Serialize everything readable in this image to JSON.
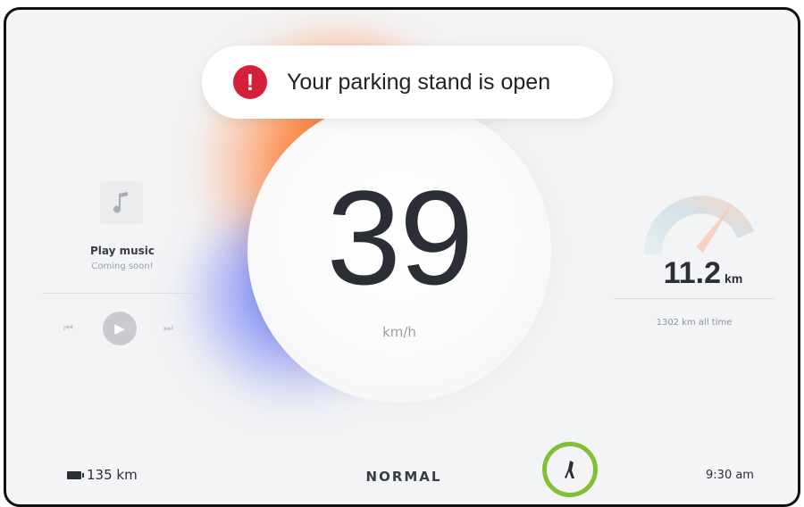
{
  "notification": {
    "icon": "alert-icon",
    "icon_glyph": "!",
    "message": "Your parking stand is open",
    "icon_color": "#d31f3a"
  },
  "speedometer": {
    "value": "39",
    "unit": "km/h"
  },
  "music": {
    "title": "Play music",
    "subtitle": "Coming soon!",
    "cover_icon": "music-note-icon",
    "controls": [
      "previous-icon",
      "play-icon",
      "next-icon"
    ]
  },
  "trip": {
    "distance": "11.2",
    "unit": "km",
    "all_time": "1302 km all time",
    "gauge_icon": "gauge-icon"
  },
  "status_bar": {
    "range": "135 km",
    "range_icon": "battery-icon",
    "mode": "NORMAL",
    "stand_icon": "kickstand-icon",
    "stand_ring_color": "#7fc133",
    "time": "9:30 am"
  },
  "colors": {
    "accent_orange": "#ff6a1f",
    "accent_blue": "#5b6cf0",
    "background": "#f3f4f5"
  }
}
